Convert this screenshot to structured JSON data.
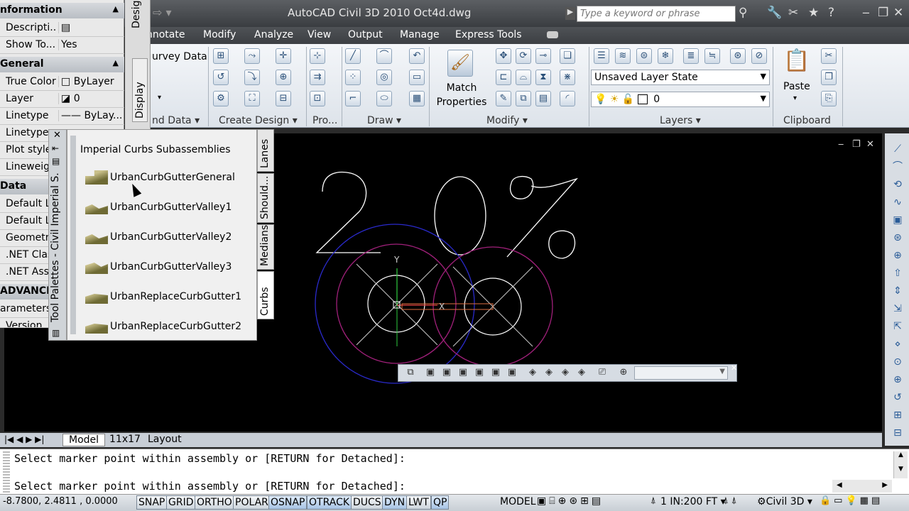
{
  "window": {
    "title": "AutoCAD Civil 3D 2010     Oct4d.dwg",
    "search_placeholder": "Type a keyword or phrase"
  },
  "menus": [
    "nnotate",
    "Modify",
    "Analyze",
    "View",
    "Output",
    "Manage",
    "Express Tools"
  ],
  "ribbon": {
    "panels": [
      "nd Data",
      "Create Design",
      "Pro...",
      "Draw",
      "Modify",
      "Layers",
      "Clipboard"
    ],
    "survey_data": "urvey Data",
    "match_properties": "Match\nProperties",
    "layer_state": "Unsaved Layer State",
    "layer_current": "0",
    "paste": "Paste"
  },
  "properties": {
    "sections": {
      "information": "nformation",
      "general": "General",
      "data": "Data",
      "advanced": "ADVANCE"
    },
    "rows": [
      {
        "name": "Descripti...",
        "value": ""
      },
      {
        "name": "Show To...",
        "value": "Yes"
      },
      {
        "name": "True Color",
        "value": "ByLayer"
      },
      {
        "name": "Layer",
        "value": "0"
      },
      {
        "name": "Linetype",
        "value": "ByLay..."
      },
      {
        "name": "Linetype",
        "value": ""
      },
      {
        "name": "Plot style",
        "value": ""
      },
      {
        "name": "Lineweig",
        "value": ""
      },
      {
        "name": "Default L",
        "value": ""
      },
      {
        "name": "Default L",
        "value": ""
      },
      {
        "name": "Geometr",
        "value": ""
      },
      {
        "name": ".NET Clas",
        "value": ""
      },
      {
        "name": ".NET Ass",
        "value": ""
      },
      {
        "name": "arameters",
        "value": ""
      },
      {
        "name": "Version",
        "value": ""
      }
    ],
    "tabs": [
      "Design",
      "Display"
    ]
  },
  "tool_palette": {
    "title": "Imperial Curbs Subassemblies",
    "side_title": "Tool Palettes - Civil Imperial S...",
    "items": [
      "UrbanCurbGutterGeneral",
      "UrbanCurbGutterValley1",
      "UrbanCurbGutterValley2",
      "UrbanCurbGutterValley3",
      "UrbanReplaceCurbGutter1",
      "UrbanReplaceCurbGutter2"
    ],
    "tabs": [
      "Lanes",
      "Should...",
      "Medians",
      "Curbs"
    ]
  },
  "drawing": {
    "text_glyphs": "20%",
    "ucs_y": "Y",
    "ucs_x": "X"
  },
  "layout_tabs": [
    "Model",
    "11x17",
    "Layout"
  ],
  "command_line": {
    "line1": "Select marker point within assembly or [RETURN for Detached]:",
    "line2": "Select marker point within assembly or [RETURN for Detached]:"
  },
  "status_bar": {
    "coords": "-8.7800, 2.4811 , 0.0000",
    "toggles": [
      "SNAP",
      "GRID",
      "ORTHO",
      "POLAR",
      "OSNAP",
      "OTRACK",
      "DUCS",
      "DYN",
      "LWT",
      "QP"
    ],
    "model": "MODEL",
    "scale": "1 IN:200 FT",
    "workspace": "Civil 3D"
  },
  "colors": {
    "drawing_bg": "#000000",
    "circle_blue": "#2a2acc",
    "circle_magenta": "#a0207a",
    "ribbon_bg": "#e6ebf0"
  }
}
